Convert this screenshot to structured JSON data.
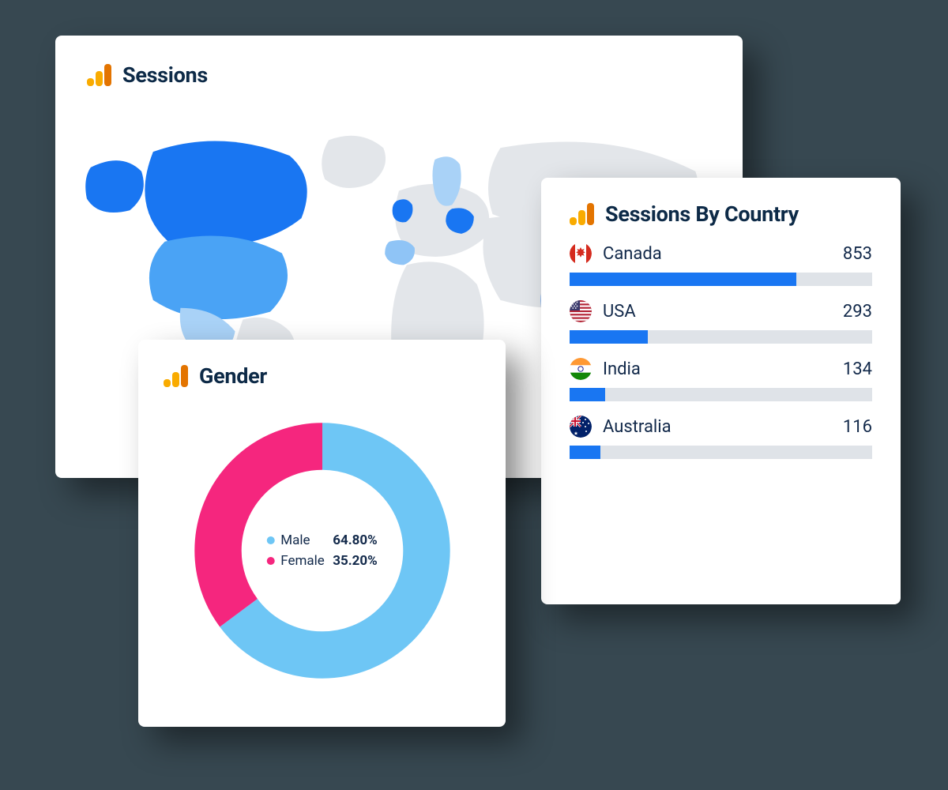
{
  "sessions": {
    "title": "Sessions"
  },
  "gender": {
    "title": "Gender",
    "legend": {
      "male_label": "Male",
      "male_value": "64.80%",
      "female_label": "Female",
      "female_value": "35.20%"
    }
  },
  "country": {
    "title": "Sessions By Country",
    "rows": [
      {
        "name": "Canada",
        "value": "853",
        "flag": "canada"
      },
      {
        "name": "USA",
        "value": "293",
        "flag": "usa"
      },
      {
        "name": "India",
        "value": "134",
        "flag": "india"
      },
      {
        "name": "Australia",
        "value": "116",
        "flag": "australia"
      }
    ]
  },
  "colors": {
    "blue": "#1976f2",
    "lightblue": "#6ec6f5",
    "pink": "#f5267e",
    "grey_map": "#e3e6ea"
  },
  "chart_data": [
    {
      "type": "pie",
      "title": "Gender",
      "series": [
        {
          "name": "Male",
          "value": 64.8,
          "color": "#6ec6f5"
        },
        {
          "name": "Female",
          "value": 35.2,
          "color": "#f5267e"
        }
      ]
    },
    {
      "type": "bar",
      "title": "Sessions By Country",
      "categories": [
        "Canada",
        "USA",
        "India",
        "Australia"
      ],
      "values": [
        853,
        293,
        134,
        116
      ],
      "xlabel": "",
      "ylabel": "Sessions"
    }
  ]
}
